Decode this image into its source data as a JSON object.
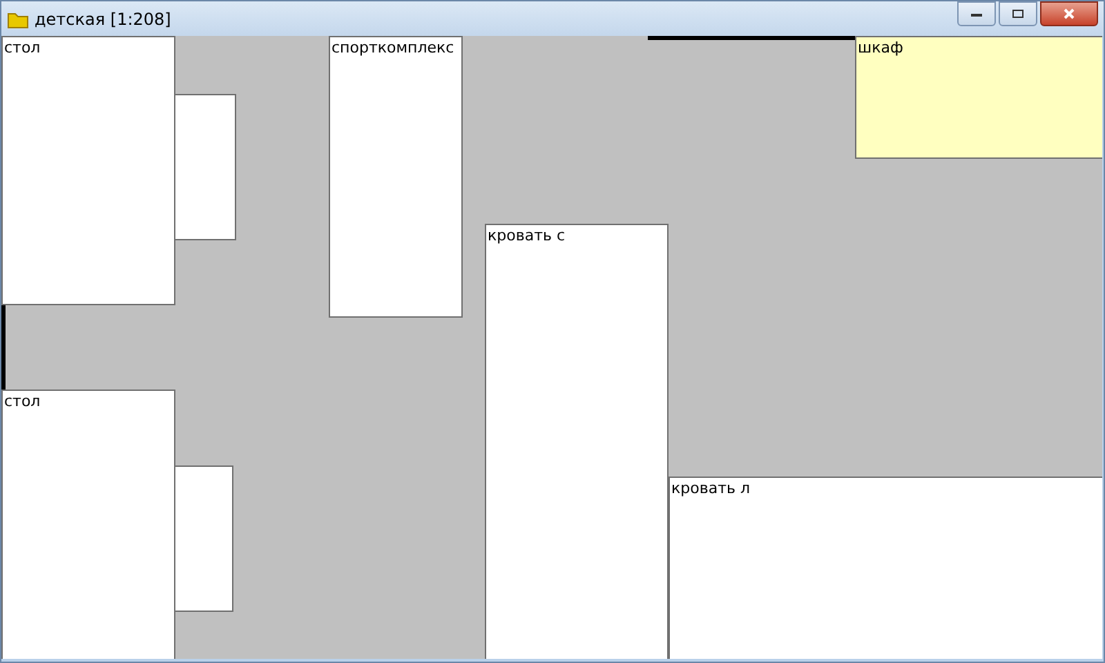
{
  "window": {
    "title": "детская [1:208]"
  },
  "items": [
    {
      "label": "стол",
      "selected": false
    },
    {
      "selected": false
    },
    {
      "label": "спорткомплекс",
      "selected": false
    },
    {
      "label": "кровать с",
      "selected": false
    },
    {
      "label": "шкаф",
      "selected": true
    },
    {
      "label": "стол",
      "selected": false
    },
    {
      "selected": false
    },
    {
      "label": "кровать л",
      "selected": false
    }
  ]
}
